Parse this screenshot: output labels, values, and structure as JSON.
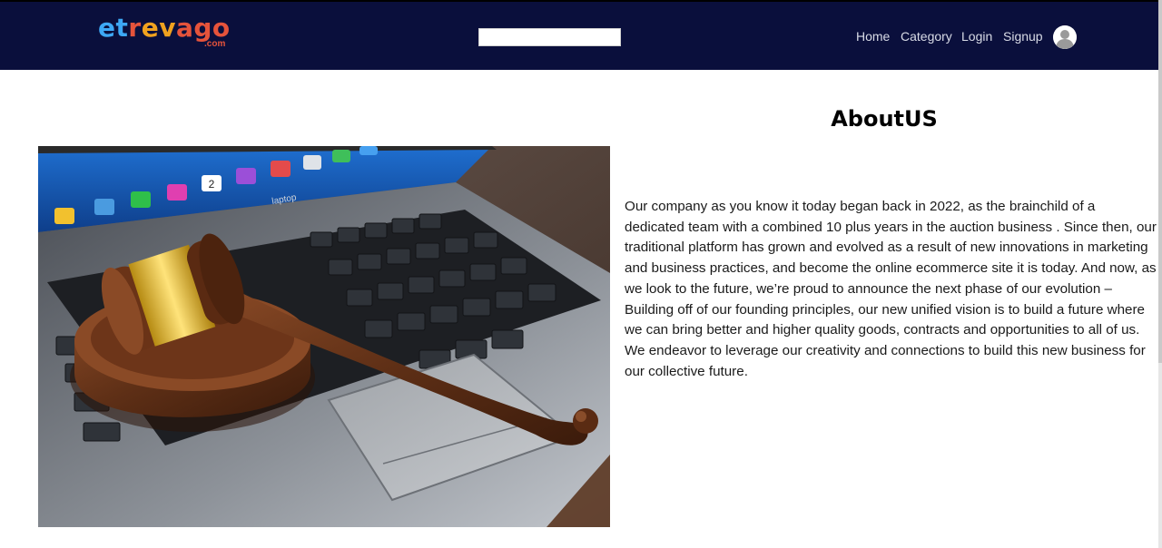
{
  "header": {
    "logo": {
      "letters": [
        {
          "char": "e",
          "color": "#3da8f5"
        },
        {
          "char": "t",
          "color": "#3da8f5"
        },
        {
          "char": "r",
          "color": "#e5533b"
        },
        {
          "char": "e",
          "color": "#f0a21f"
        },
        {
          "char": "v",
          "color": "#f0a21f"
        },
        {
          "char": "a",
          "color": "#e5533b"
        },
        {
          "char": "g",
          "color": "#e5533b"
        },
        {
          "char": "o",
          "color": "#e5533b"
        }
      ],
      "suffix": ".com",
      "suffix_color": "#e5533b"
    },
    "search": {
      "value": "",
      "placeholder": ""
    },
    "nav": [
      {
        "label": "Home"
      },
      {
        "label": "Category"
      },
      {
        "label": "Login"
      },
      {
        "label": "Signup"
      }
    ],
    "avatar_icon": "user-avatar-icon"
  },
  "main": {
    "title": "AboutUS",
    "body": "Our company as you know it today began back in 2022, as the brainchild of a dedicated team with a combined 10 plus years in the auction business . Since then, our traditional platform has grown and evolved as a result of new innovations in marketing and business practices, and become the online ecommerce site it is today. And now, as we look to the future, we’re proud to announce the next phase of our evolution – Building off of our founding principles, our new unified vision is to build a future where we can bring better and higher quality goods, contracts and opportunities to all of us. We endeavor to leverage our creativity and connections to build this new business for our collective future.",
    "image_icon": "gavel-on-laptop-image",
    "laptop_brand": "laptop",
    "key_label_2": "2"
  },
  "colors": {
    "navbar_bg": "#0a0f3c",
    "nav_text": "#d8dbe6",
    "page_bg": "#ffffff"
  }
}
